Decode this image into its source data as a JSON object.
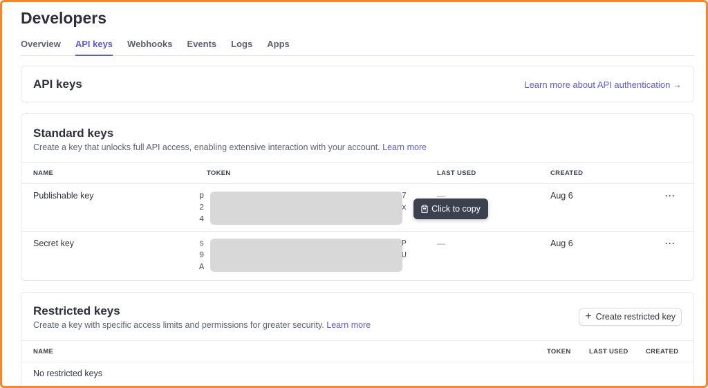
{
  "header": {
    "title": "Developers"
  },
  "tabs": [
    {
      "label": "Overview"
    },
    {
      "label": "API keys",
      "active": true
    },
    {
      "label": "Webhooks"
    },
    {
      "label": "Events"
    },
    {
      "label": "Logs"
    },
    {
      "label": "Apps"
    }
  ],
  "api_keys_card": {
    "title": "API keys",
    "link": "Learn more about API authentication →"
  },
  "standard_keys": {
    "title": "Standard keys",
    "description": "Create a key that unlocks full API access, enabling extensive interaction with your account.",
    "learn_more": "Learn more",
    "columns": {
      "name": "NAME",
      "token": "TOKEN",
      "last_used": "LAST USED",
      "created": "CREATED"
    },
    "rows": [
      {
        "name": "Publishable key",
        "token_lines": [
          [
            "p",
            "7"
          ],
          [
            "2",
            "x"
          ],
          [
            "4",
            ""
          ]
        ],
        "last_used": "—",
        "created": "Aug 6",
        "menu": "···"
      },
      {
        "name": "Secret key",
        "token_lines": [
          [
            "s",
            "P"
          ],
          [
            "9",
            "U"
          ],
          [
            "A",
            ""
          ]
        ],
        "last_used": "—",
        "created": "Aug 6",
        "menu": "···"
      }
    ]
  },
  "tooltip": {
    "text": "Click to copy",
    "icon": "clipboard-icon"
  },
  "restricted_keys": {
    "title": "Restricted keys",
    "description": "Create a key with specific access limits and permissions for greater security.",
    "learn_more": "Learn more",
    "create_button": "Create restricted key",
    "columns": {
      "name": "NAME",
      "token": "TOKEN",
      "last_used": "LAST USED",
      "created": "CREATED"
    },
    "empty_text": "No restricted keys"
  },
  "colors": {
    "accent": "#5b5bd6",
    "frame": "#f5862e",
    "redaction": "#d8d8d8",
    "tooltip_bg": "#3c4150"
  }
}
